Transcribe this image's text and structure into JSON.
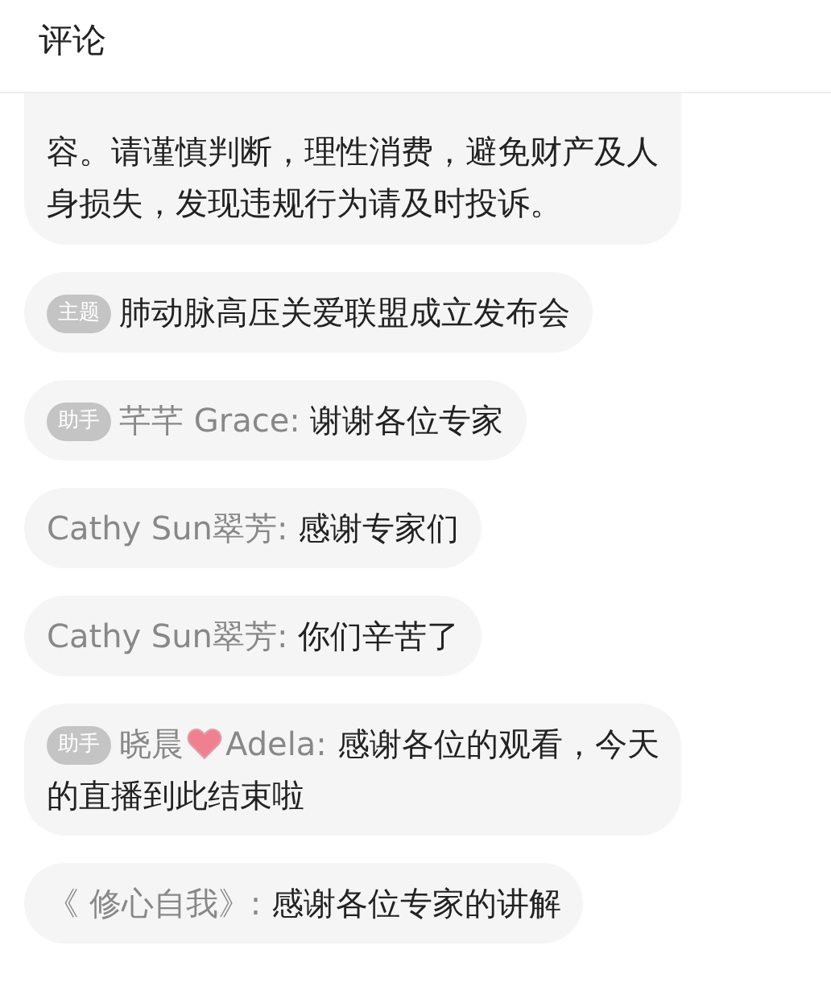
{
  "header": {
    "title": "评论"
  },
  "comments": [
    {
      "lines": [
        "容。请谨慎判断，理性消费，避免财产及人",
        "身损失，发现违规行为请及时投诉。"
      ],
      "cut_top": true
    },
    {
      "badge": "主题",
      "text": "肺动脉高压关爱联盟成立发布会"
    },
    {
      "badge": "助手",
      "name": [
        {
          "kind": "text",
          "text": "芊芊 Grace:"
        }
      ],
      "text": "谢谢各位专家"
    },
    {
      "name": [
        {
          "kind": "text",
          "text": "Cathy Sun翠芳:"
        }
      ],
      "text": "感谢专家们"
    },
    {
      "name": [
        {
          "kind": "text",
          "text": "Cathy Sun翠芳:"
        }
      ],
      "text": "你们辛苦了"
    },
    {
      "badge": "助手",
      "name": [
        {
          "kind": "text",
          "text": "晓晨"
        },
        {
          "kind": "heart"
        },
        {
          "kind": "text",
          "text": "Adela:"
        }
      ],
      "lines": [
        "感谢各位的观看，今天",
        "的直播到此结束啦"
      ]
    },
    {
      "name": [
        {
          "kind": "text",
          "text": "《 修心自我》:"
        }
      ],
      "text": "感谢各位专家的讲解"
    }
  ]
}
